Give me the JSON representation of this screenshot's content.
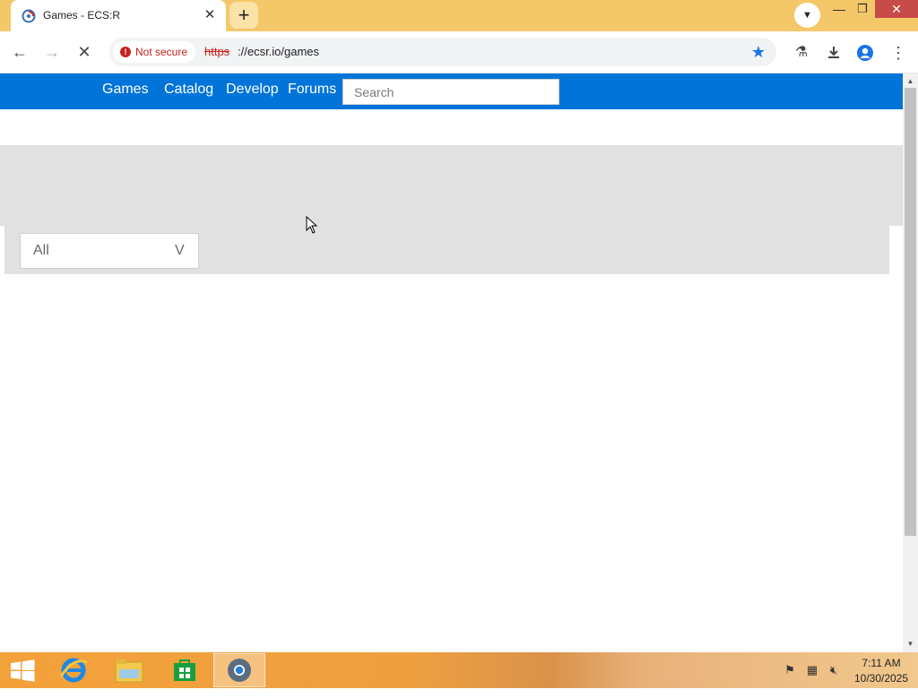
{
  "browser": {
    "tab_title": "Games - ECS:R",
    "tab_close": "✕",
    "new_tab": "+",
    "window": {
      "minimize": "—",
      "restore": "❐",
      "close": "✕"
    },
    "security_label": "Not secure",
    "url_scheme": "https",
    "url_rest": "://ecsr.io/games"
  },
  "site_nav": {
    "links": [
      "Games",
      "Catalog",
      "Develop",
      "Forums"
    ],
    "search_placeholder": "Search"
  },
  "games_filter": {
    "genre_value": "All",
    "genre_caret": "V"
  },
  "taskbar": {
    "clock_time": "7:11 AM",
    "clock_date": "10/30/2025"
  },
  "colors": {
    "title_bar": "#f4c869",
    "site_nav": "#0074d9",
    "banner": "#e1e1e1",
    "not_secure": "#c5221f",
    "bookmark": "#1a73e8"
  }
}
